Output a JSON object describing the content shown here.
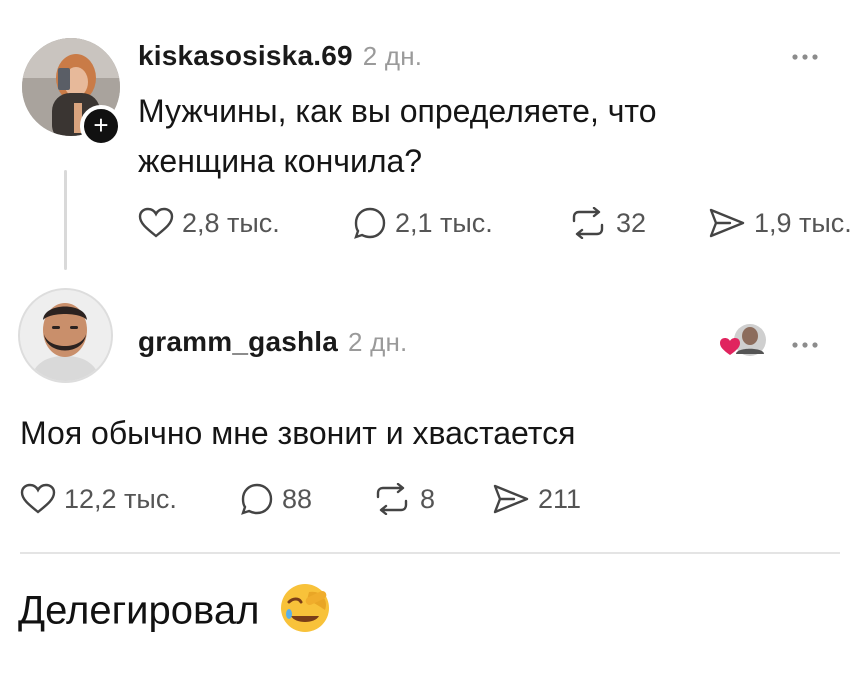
{
  "post1": {
    "username": "kiskasosiska.69",
    "time": "2 дн.",
    "more_icon": "more-dots-icon",
    "text_line1": "Мужчины, как вы определяете, что",
    "text_line2": "женщина кончила?",
    "likes": "2,8 тыс.",
    "comments": "2,1 тыс.",
    "reposts": "32",
    "shares": "1,9 тыс."
  },
  "post2": {
    "username": "gramm_gashla",
    "time": "2 дн.",
    "text": "Моя обычно мне звонит и хвастается",
    "likes": "12,2 тыс.",
    "comments": "88",
    "reposts": "8",
    "shares": "211"
  },
  "caption": {
    "text": "Делегировал",
    "emoji_icon": "face-palm-laughing-icon"
  },
  "colors": {
    "text": "#111111",
    "muted": "#9a9a9a",
    "divider": "#e4e4e4",
    "heart_accent": "#e0245e"
  }
}
